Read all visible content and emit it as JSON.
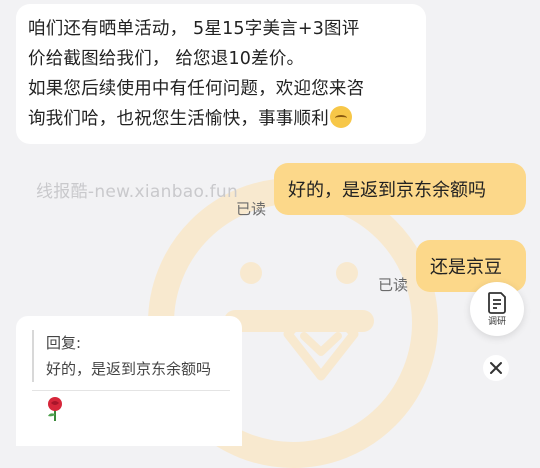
{
  "watermark": {
    "source_text": "线报酷-new.xianbao.fun"
  },
  "messages": {
    "incoming": {
      "line1": "咱们还有晒单活动，  5星15字美言+3图评",
      "line2": "价给截图给我们，  给您退10差价。",
      "line3": "如果您后续使用中有任何问题，欢迎您来咨",
      "line4": "询我们哈，也祝您生活愉快，事事顺利",
      "emoji": "pensive-face-icon"
    },
    "outgoing": [
      {
        "text": "好的，是返到京东余额吗",
        "status": "已读"
      },
      {
        "text": "还是京豆",
        "status": "已读"
      }
    ]
  },
  "floating": {
    "survey_label": "调研",
    "close_icon": "close-icon"
  },
  "quote_card": {
    "reply_label": "回复:",
    "quoted_text": "好的，是返到京东余额吗",
    "sticker": "rose-icon"
  },
  "colors": {
    "background": "#f2f2f4",
    "incoming_bubble": "#ffffff",
    "outgoing_bubble": "#fcd88a",
    "watermark": "#f8e9cf"
  }
}
